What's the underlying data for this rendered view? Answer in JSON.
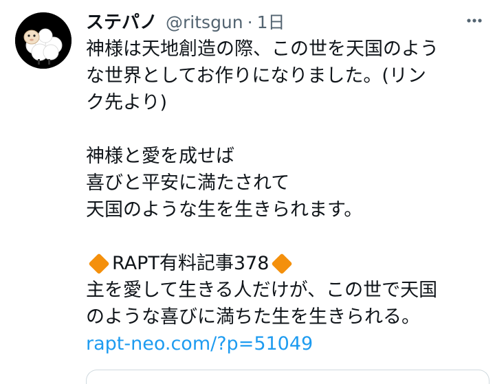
{
  "tweet": {
    "author_name": "ステパノ",
    "author_handle": "@ritsgun",
    "separator": "·",
    "timestamp": "1日",
    "more_icon": "more-dots-icon",
    "avatar_icon": "sheep-avatar-icon",
    "text_lines": [
      "神様は天地創造の際、この世を天国のよう",
      "な世界としてお作りになりました。(リン",
      "ク先より)",
      "",
      "神様と愛を成せば",
      "喜びと平安に満たされて",
      "天国のような生を生きられます。",
      ""
    ],
    "article_title": "RAPT有料記事378",
    "article_lines": [
      "主を愛して生きる人だけが、この世で天国",
      "のような喜びに満ちた生を生きられる。"
    ],
    "link": "rapt-neo.com/?p=51049",
    "accent_color": "#1d9bf0",
    "diamond_color": "#f4900c"
  }
}
